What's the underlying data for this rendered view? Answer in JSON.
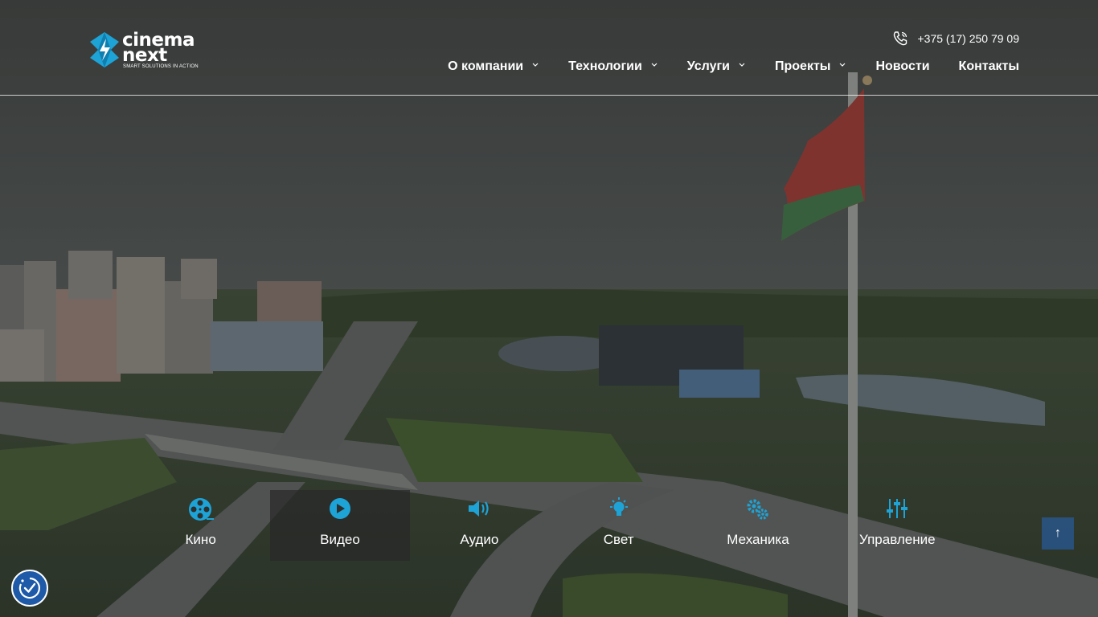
{
  "brand": {
    "word1": "cinema",
    "word2": "next",
    "tagline": "SMART SOLUTIONS IN ACTION",
    "accent_color": "#1ea3d6"
  },
  "header": {
    "phone": "+375 (17) 250 79 09",
    "phone_icon": "phone-icon"
  },
  "nav": {
    "items": [
      {
        "label": "О компании",
        "has_dropdown": true
      },
      {
        "label": "Технологии",
        "has_dropdown": true
      },
      {
        "label": "Услуги",
        "has_dropdown": true
      },
      {
        "label": "Проекты",
        "has_dropdown": true
      },
      {
        "label": "Новости",
        "has_dropdown": false
      },
      {
        "label": "Контакты",
        "has_dropdown": false
      }
    ]
  },
  "services": {
    "icon_color": "#1ea3d6",
    "active_index": 1,
    "items": [
      {
        "label": "Кино",
        "icon": "film-reel-icon"
      },
      {
        "label": "Видео",
        "icon": "play-icon"
      },
      {
        "label": "Аудио",
        "icon": "speaker-icon"
      },
      {
        "label": "Свет",
        "icon": "lightbulb-icon"
      },
      {
        "label": "Механика",
        "icon": "gears-icon"
      },
      {
        "label": "Управление",
        "icon": "sliders-icon"
      }
    ]
  },
  "floating": {
    "to_top_glyph": "↑",
    "accessibility_icon": "accessibility-icon"
  }
}
